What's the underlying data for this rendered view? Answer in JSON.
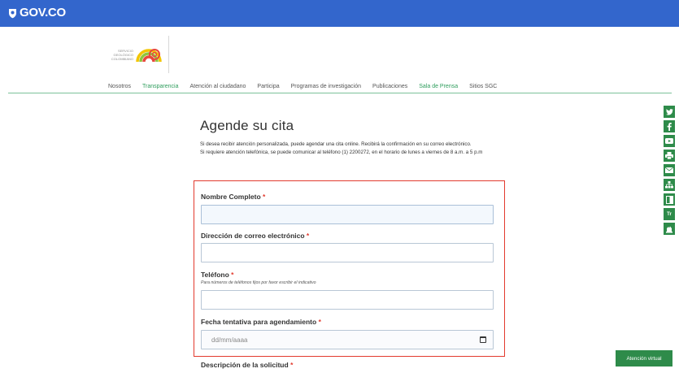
{
  "gov_bar": {
    "logo_text": "GOV.CO",
    "bg_color": "#3366cc"
  },
  "sgc_logo": {
    "line1": "SERVICIO",
    "line2": "GEOLÓGICO",
    "line3": "COLOMBIANO"
  },
  "nav": {
    "items": [
      {
        "label": "Nosotros",
        "highlight": false
      },
      {
        "label": "Transparencia",
        "highlight": true
      },
      {
        "label": "Atención al ciudadano",
        "highlight": false
      },
      {
        "label": "Participa",
        "highlight": false
      },
      {
        "label": "Programas de investigación",
        "highlight": false
      },
      {
        "label": "Publicaciones",
        "highlight": false
      },
      {
        "label": "Sala de Prensa",
        "highlight": true
      },
      {
        "label": "Sitios SGC",
        "highlight": false
      }
    ]
  },
  "page": {
    "title": "Agende su cita",
    "intro_line1": "Si desea recibir atención personalizada, puede agendar una cita online. Recibirá la confirmación en su correo electrónico.",
    "intro_line2": "Si requiere atención telefónica, se puede comunicar al teléfono (1) 2200272, en el horario de lunes a viernes de 8 a.m. a 5 p.m"
  },
  "form": {
    "required_mark": "*",
    "name_label": "Nombre Completo",
    "name_value": "",
    "email_label": "Dirección de correo electrónico",
    "email_value": "",
    "phone_label": "Teléfono",
    "phone_hint": "Para números de teléfonos fijos por favor escribir el indicativo",
    "phone_value": "",
    "date_label": "Fecha tentativa para agendamiento",
    "date_placeholder": "dd/mm/aaaa",
    "description_label": "Descripción de la solicitud"
  },
  "social": {
    "icons": [
      "twitter-icon",
      "facebook-icon",
      "youtube-icon",
      "print-icon",
      "email-icon",
      "sitemap-icon",
      "contrast-icon",
      "text-size-icon",
      "accessibility-icon"
    ],
    "text_size_glyph": "Tr"
  },
  "virtual": {
    "label": "Atención virtual"
  },
  "colors": {
    "accent_green": "#2e8b4a",
    "nav_green": "#2e9d5c",
    "required_red": "#e23a2e",
    "gov_blue": "#3366cc"
  }
}
